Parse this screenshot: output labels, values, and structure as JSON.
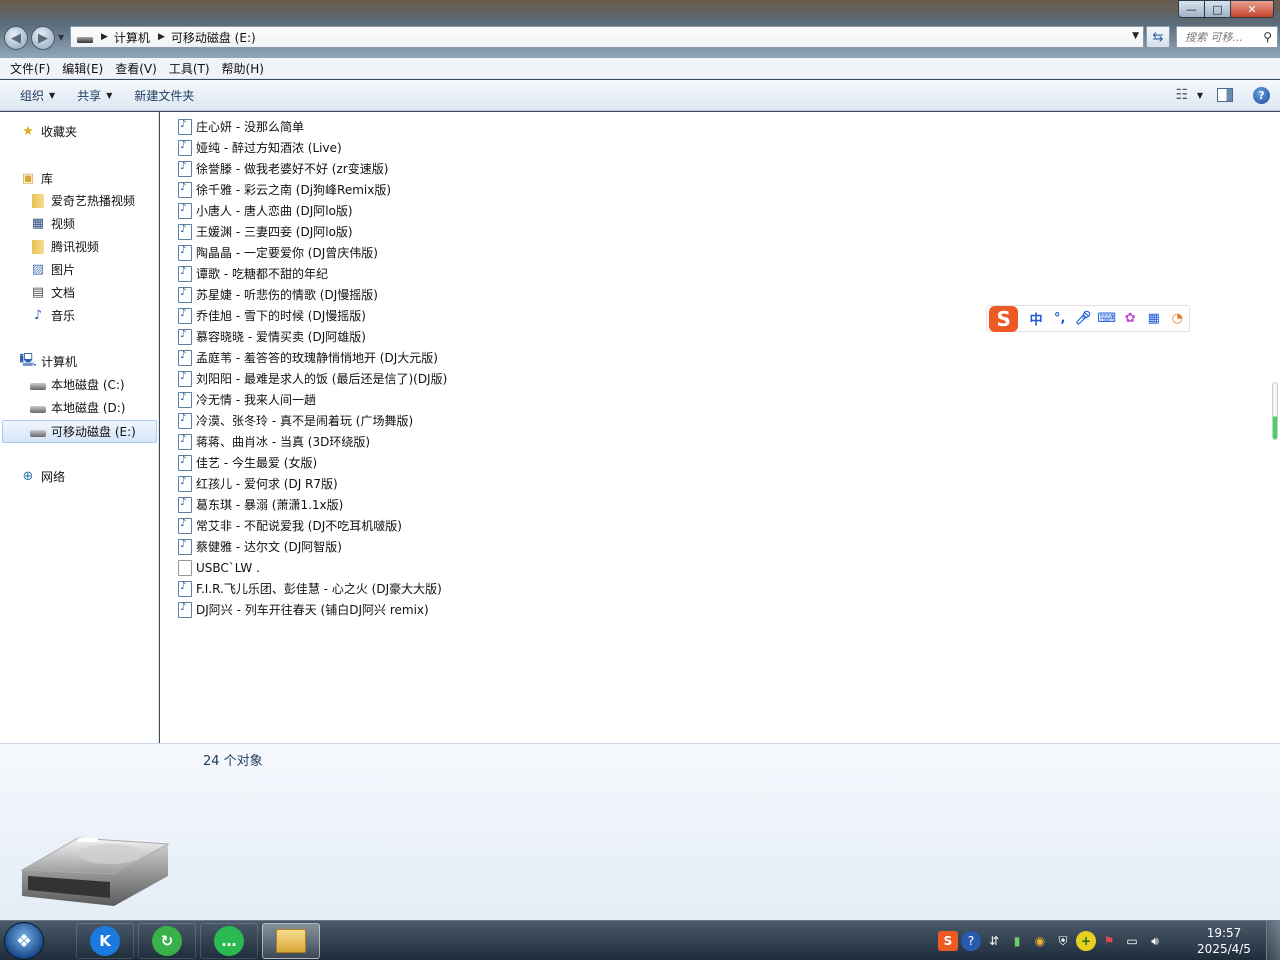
{
  "window": {
    "controls": {
      "minimize": "—",
      "maximize": "□",
      "close": "✕"
    }
  },
  "address": {
    "crumbs": [
      "计算机",
      "可移动磁盘 (E:)"
    ],
    "search_placeholder": "搜索 可移..."
  },
  "menu": [
    "文件(F)",
    "编辑(E)",
    "查看(V)",
    "工具(T)",
    "帮助(H)"
  ],
  "commands": {
    "organize": "组织",
    "share": "共享",
    "new_folder": "新建文件夹"
  },
  "nav": {
    "favorites": "收藏夹",
    "libraries": "库",
    "library_items": [
      "爱奇艺热播视频",
      "视频",
      "腾讯视频",
      "图片",
      "文档",
      "音乐"
    ],
    "computer": "计算机",
    "drives": [
      "本地磁盘 (C:)",
      "本地磁盘 (D:)",
      "可移动磁盘 (E:)"
    ],
    "network": "网络"
  },
  "files": [
    {
      "name": "庄心妍 - 没那么简单",
      "type": "audio"
    },
    {
      "name": "娅纯 - 醉过方知酒浓 (Live)",
      "type": "audio"
    },
    {
      "name": "徐誉滕 - 做我老婆好不好 (zr变速版)",
      "type": "audio"
    },
    {
      "name": "徐千雅 - 彩云之南 (Dj狗峰Remix版)",
      "type": "audio"
    },
    {
      "name": "小唐人 - 唐人恋曲 (DJ阿lo版)",
      "type": "audio"
    },
    {
      "name": "王媛渊 - 三妻四妾 (DJ阿lo版)",
      "type": "audio"
    },
    {
      "name": "陶晶晶 - 一定要爱你 (DJ曾庆伟版)",
      "type": "audio"
    },
    {
      "name": "谭歌 - 吃糖都不甜的年纪",
      "type": "audio"
    },
    {
      "name": "苏星婕 - 听悲伤的情歌 (DJ慢摇版)",
      "type": "audio"
    },
    {
      "name": "乔佳旭 - 雪下的时候 (DJ慢摇版)",
      "type": "audio"
    },
    {
      "name": "慕容晓晓 - 爱情买卖 (DJ阿雄版)",
      "type": "audio"
    },
    {
      "name": "孟庭苇 - 羞答答的玫瑰静悄悄地开 (DJ大元版)",
      "type": "audio"
    },
    {
      "name": "刘阳阳 - 最难是求人的饭 (最后还是信了)(DJ版)",
      "type": "audio"
    },
    {
      "name": "冷无情 - 我来人间一趟",
      "type": "audio"
    },
    {
      "name": "冷漠、张冬玲 - 真不是闹着玩 (广场舞版)",
      "type": "audio"
    },
    {
      "name": "蒋蒋、曲肖冰 - 当真 (3D环绕版)",
      "type": "audio"
    },
    {
      "name": "佳艺 - 今生最爱 (女版)",
      "type": "audio"
    },
    {
      "name": "红孩儿 - 爱何求 (DJ R7版)",
      "type": "audio"
    },
    {
      "name": "葛东琪 - 暴溺 (萧潇1.1x版)",
      "type": "audio"
    },
    {
      "name": "常艾非 - 不配说爱我 (DJ不吃耳机啵版)",
      "type": "audio"
    },
    {
      "name": "蔡健雅 - 达尔文 (DJ阿智版)",
      "type": "audio"
    },
    {
      "name": "USBC`LW .",
      "type": "file"
    },
    {
      "name": "F.I.R.飞儿乐团、彭佳慧 - 心之火 (DJ豪大大版)",
      "type": "audio"
    },
    {
      "name": "DJ阿兴 - 列车开往春天 (铺白DJ阿兴 remix)",
      "type": "audio"
    }
  ],
  "status": {
    "count": "24 个对象"
  },
  "ime": {
    "logo": "S",
    "lang": "中",
    "punct": "°,"
  },
  "taskbar": {
    "time": "19:57",
    "date": "2025/4/5"
  },
  "colors": {
    "accent": "#1e395b",
    "ime": "#ee5a24",
    "selection": "#d5e5f9"
  }
}
